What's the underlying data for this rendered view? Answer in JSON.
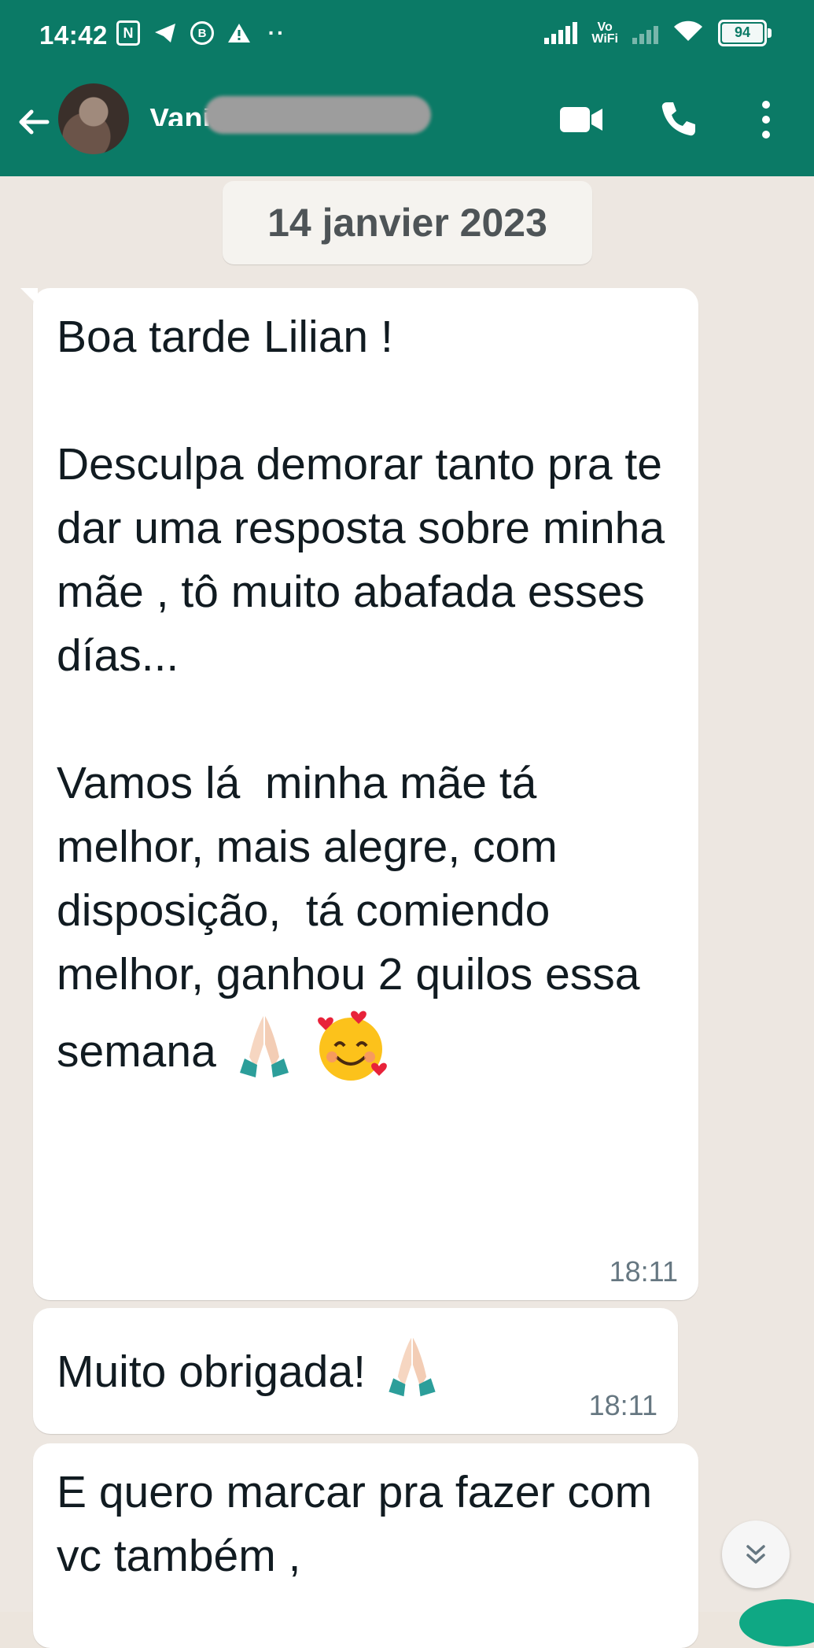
{
  "status_bar": {
    "time": "14:42",
    "icons": [
      "nfc-icon",
      "telegram-icon",
      "b-circle-icon",
      "warning-icon",
      "more-dots-icon"
    ],
    "vowifi_top": "Vo",
    "vowifi_bottom": "WiFi",
    "battery": "94"
  },
  "chat_header": {
    "contact_name": "Vania",
    "icons": [
      "back-arrow-icon",
      "video-call-icon",
      "voice-call-icon",
      "overflow-menu-icon"
    ]
  },
  "date_separator": "14 janvier 2023",
  "messages": [
    {
      "text": "Boa tarde Lilian !\n\nDesculpa demorar tanto pra te dar uma resposta sobre minha mãe , tô muito abafada esses días...\n\nVamos lá  minha mãe tá melhor, mais alegre, com disposição,  tá comiendo melhor, ganhou 2 quilos essa semana",
      "emojis": [
        "folded-hands",
        "smiling-face-with-hearts"
      ],
      "time": "18:11"
    },
    {
      "text": "Muito obrigada!",
      "emojis": [
        "folded-hands"
      ],
      "time": "18:11"
    },
    {
      "text": "E quero marcar pra fazer com vc também ,",
      "emojis": [],
      "time": ""
    }
  ],
  "colors": {
    "header": "#0b7a66",
    "chat_background": "#ede7e1",
    "bubble": "#ffffff",
    "timestamp": "#667781"
  }
}
